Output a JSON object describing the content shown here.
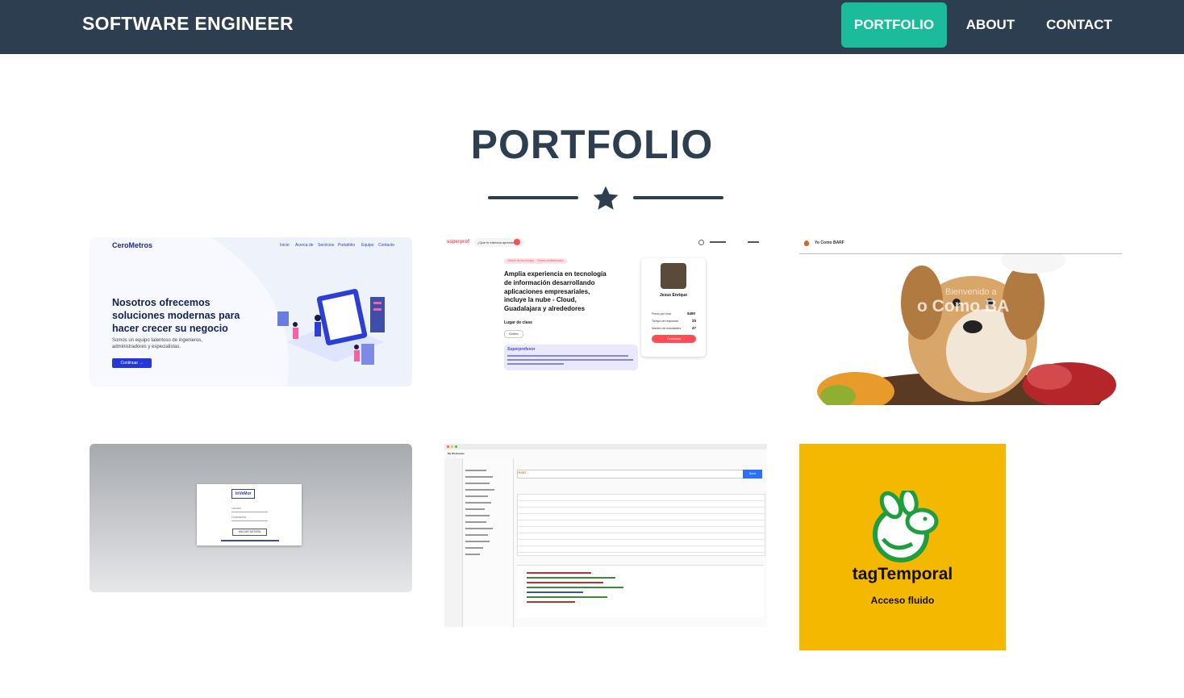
{
  "nav": {
    "brand": "SOFTWARE ENGINEER",
    "links": [
      {
        "label": "PORTFOLIO",
        "active": true
      },
      {
        "label": "ABOUT",
        "active": false
      },
      {
        "label": "CONTACT",
        "active": false
      }
    ]
  },
  "section": {
    "title": "PORTFOLIO",
    "divider_icon": "star-icon"
  },
  "colors": {
    "navbar": "#2c3e50",
    "accent": "#1abc9c",
    "tag_bg": "#f5b800",
    "tag_green": "#1e9e3e"
  },
  "cards": {
    "cerometros": {
      "logo": "CeroMetros",
      "menu": [
        "Inicio",
        "Acerca de",
        "Servicios",
        "Portafolio",
        "Equipo",
        "Contacto"
      ],
      "headline": [
        "Nosotros ofrecemos",
        "soluciones modernas para",
        "hacer crecer su negocio"
      ],
      "sub": [
        "Somos un equipo talentoso de ingenieros,",
        "administradores y especialistas."
      ],
      "button": "Continuar →"
    },
    "superprof": {
      "logo": "superprof",
      "search": "¿Qué te interesa aprender?",
      "tags": [
        "Clases de tecnología",
        "Clases profesionales"
      ],
      "headline": [
        "Amplia experiencia en tecnología",
        "de información desarrollando",
        "aplicaciones empresariales,",
        "incluye la nube - Cloud,",
        "Guadalajara y alrededores"
      ],
      "place_label": "Lugar de clase",
      "place_value": "Online",
      "box_title": "Superprofesor",
      "teacher": "Jesus Enrique",
      "rows": [
        {
          "label": "Precio por hora",
          "value": "$480"
        },
        {
          "label": "Tiempo de respuesta",
          "value": "2h"
        },
        {
          "label": "Número de estudiantes",
          "value": "47"
        }
      ],
      "cta": "Contactar"
    },
    "barf": {
      "header": "Yo Como BARF",
      "welcome": "Bienvenido a",
      "title": "o Como BA"
    },
    "login": {
      "logo": "InVeMor",
      "user": "Usuario",
      "pass": "Contraseña",
      "button": "INICIAR SESIÓN"
    },
    "postman": {
      "workspace": "My Workspace",
      "method": "POST",
      "send": "Send"
    },
    "tag": {
      "name": "tagTemporal",
      "tagline": "Acceso fluido"
    }
  }
}
